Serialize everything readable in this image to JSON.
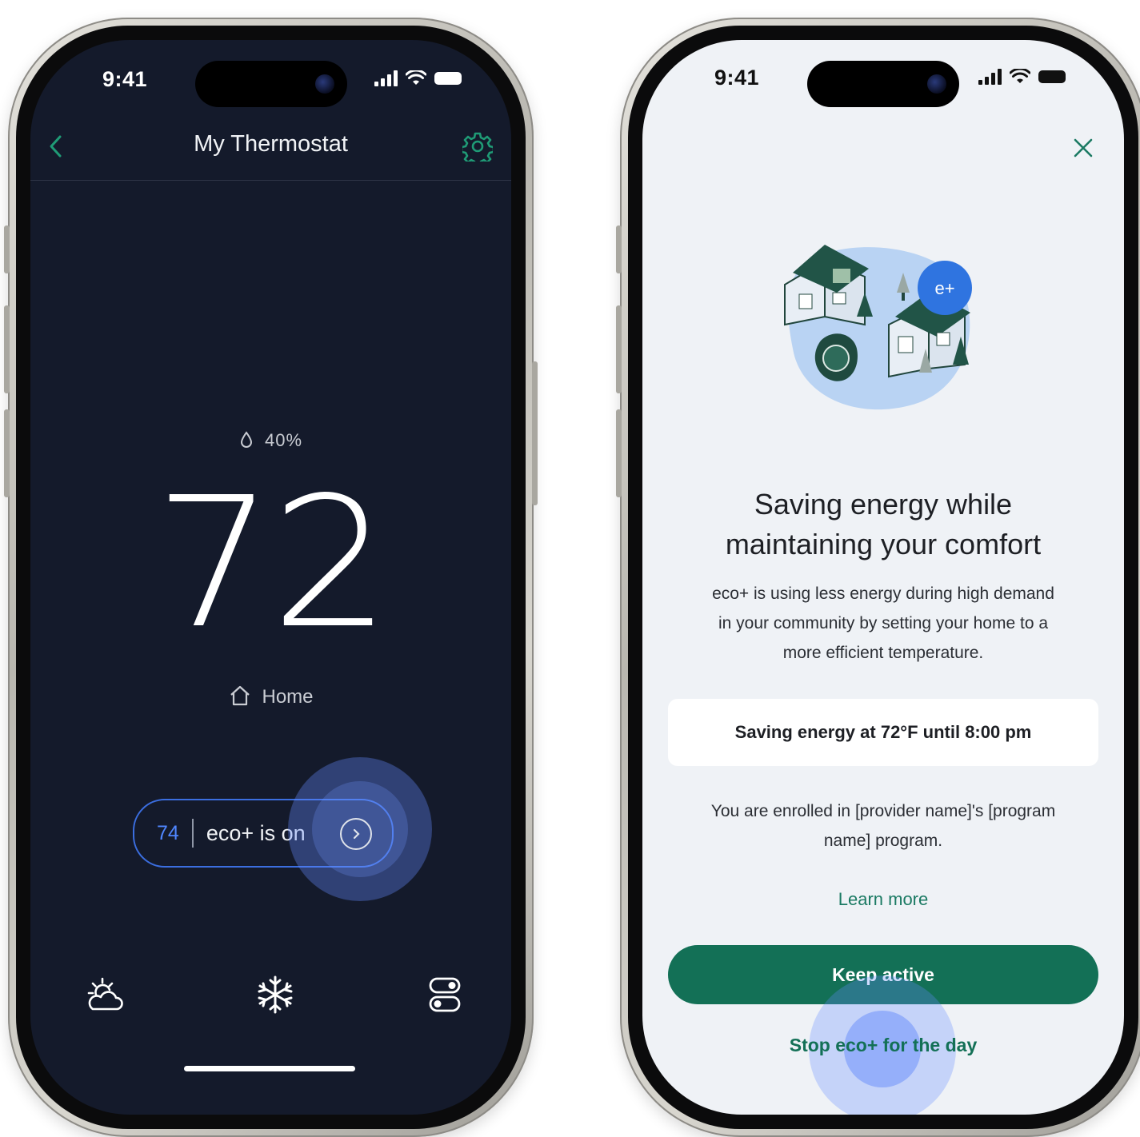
{
  "left_screen": {
    "status_bar": {
      "time": "9:41"
    },
    "nav": {
      "title": "My Thermostat"
    },
    "humidity": "40%",
    "current_temp": "72",
    "comfort_mode": "Home",
    "eco_status": {
      "setpoint": "74",
      "label": "eco+ is on"
    },
    "tabs": [
      "weather-icon",
      "snowflake-icon",
      "toggles-icon"
    ]
  },
  "right_screen": {
    "status_bar": {
      "time": "9:41"
    },
    "badge_text": "e+",
    "headline_line1": "Saving energy while",
    "headline_line2": "maintaining your comfort",
    "description_line1": "eco+ is using less energy during high demand",
    "description_line2": "in your community by setting your home to a",
    "description_line3": "more efficient temperature.",
    "saving_card": "Saving energy at 72°F until 8:00 pm",
    "enrollment_line1": "You are enrolled in [provider name]'s [program",
    "enrollment_line2": "name] program.",
    "learn_more": "Learn more",
    "keep_active": "Keep active",
    "stop_eco": "Stop eco+ for the day"
  },
  "colors": {
    "dark_bg": "#141a2b",
    "accent_blue": "#3b6ee0",
    "green_primary": "#137056",
    "light_bg": "#eff2f6"
  }
}
